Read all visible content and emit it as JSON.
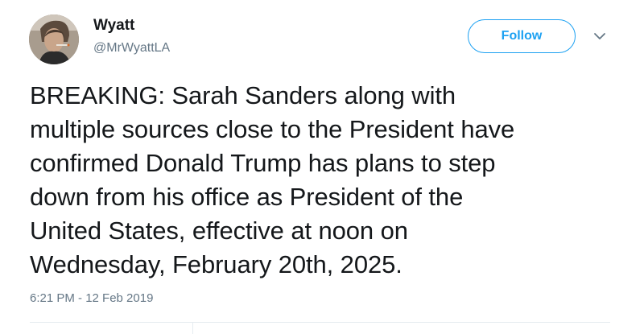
{
  "user": {
    "display_name": "Wyatt",
    "handle": "@MrWyattLA"
  },
  "actions": {
    "follow_label": "Follow",
    "menu_icon": "chevron-down-icon"
  },
  "tweet": {
    "lines": [
      "BREAKING: Sarah Sanders along with",
      "multiple sources close to the President have",
      "confirmed Donald Trump has plans to step",
      "down from his office as President of the",
      "United States, effective at noon on",
      "Wednesday, February 20th, 2025."
    ],
    "timestamp": "6:21 PM - 12 Feb 2019"
  },
  "colors": {
    "accent": "#1da1f2",
    "text_primary": "#14171a",
    "text_secondary": "#657786",
    "divider": "#e6ecf0"
  }
}
